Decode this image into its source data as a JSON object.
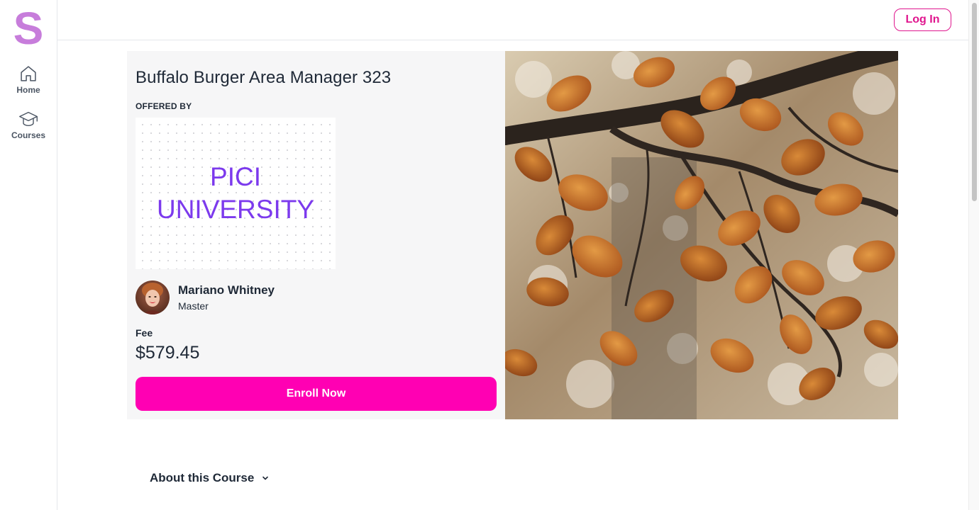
{
  "sidebar": {
    "logo": {
      "letter": "S",
      "color": "#c77ddb"
    },
    "items": [
      {
        "label": "Home",
        "icon": "home-icon"
      },
      {
        "label": "Courses",
        "icon": "graduation-cap-icon"
      }
    ]
  },
  "header": {
    "login_label": "Log In"
  },
  "course": {
    "title": "Buffalo Burger Area Manager 323",
    "offered_by_label": "OFFERED BY",
    "provider": {
      "line1": "PICI",
      "line2": "UNIVERSITY"
    },
    "instructor": {
      "name": "Mariano Whitney",
      "role": "Master"
    },
    "fee_label": "Fee",
    "fee_value": "$579.45",
    "enroll_label": "Enroll Now"
  },
  "about": {
    "label": "About this Course",
    "icon": "chevron-down-icon"
  },
  "colors": {
    "accent": "#ff00b3",
    "login": "#e0168e",
    "provider_text": "#7c3aed"
  }
}
